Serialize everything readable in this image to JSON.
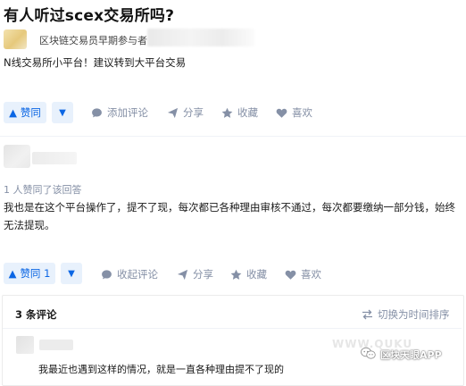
{
  "question": {
    "title": "有人听过scex交易所吗?"
  },
  "answer1": {
    "author_headline": "区块链交易员早期参与者",
    "content": "N线交易所小平台！建议转到大平台交易",
    "actions": {
      "vote_up": "赞同",
      "add_comment": "添加评论",
      "share": "分享",
      "collect": "收藏",
      "like": "喜欢"
    }
  },
  "answer2": {
    "votes_text": "1 人赞同了该回答",
    "content": "我也是在这个平台操作了，提不了现，每次都已各种理由审核不通过，每次都要缴纳一部分钱，始终无法提现。",
    "actions": {
      "vote_up": "赞同 1",
      "collapse_comment": "收起评论",
      "share": "分享",
      "collect": "收藏",
      "like": "喜欢"
    },
    "comments": {
      "count_label": "3 条评论",
      "sort_toggle": "切换为时间排序",
      "first_comment": "我最近也遇到这样的情况，就是一直各种理由提不了现的"
    }
  },
  "watermark": {
    "text": "区块天眼APP",
    "faint_text": "WWW.QUKU"
  },
  "colors": {
    "accent": "#0b66e4",
    "accent_bg": "#e8f1fc",
    "muted": "#8590a6"
  }
}
